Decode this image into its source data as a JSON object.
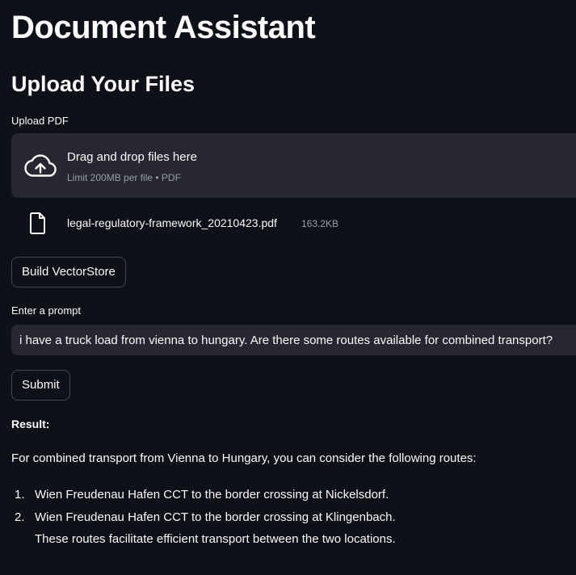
{
  "app": {
    "title": "Document Assistant",
    "subtitle": "Upload Your Files"
  },
  "upload": {
    "label": "Upload PDF",
    "dropzone_title": "Drag and drop files here",
    "dropzone_limit": "Limit 200MB per file • PDF",
    "dropzone_icon": "cloud-upload-icon",
    "file": {
      "icon": "file-icon",
      "name": "legal-regulatory-framework_20210423.pdf",
      "size": "163.2KB"
    }
  },
  "build_button": {
    "label": "Build VectorStore"
  },
  "prompt": {
    "label": "Enter a prompt",
    "value": "i have a truck load from vienna to hungary. Are there some routes available for combined transport?"
  },
  "submit_button": {
    "label": "Submit"
  },
  "result": {
    "label": "Result:",
    "intro": "For combined transport from Vienna to Hungary, you can consider the following routes:",
    "items": [
      {
        "number": "1.",
        "text": "Wien Freudenau Hafen CCT to the border crossing at Nickelsdorf."
      },
      {
        "number": "2.",
        "text": "Wien Freudenau Hafen CCT to the border crossing at Klingenbach."
      }
    ],
    "outro": "These routes facilitate efficient transport between the two locations."
  },
  "colors": {
    "background": "#0e1117",
    "surface": "#262730",
    "text": "#fafafa",
    "muted_text": "#9b9ea6",
    "button_border": "#43464f"
  }
}
